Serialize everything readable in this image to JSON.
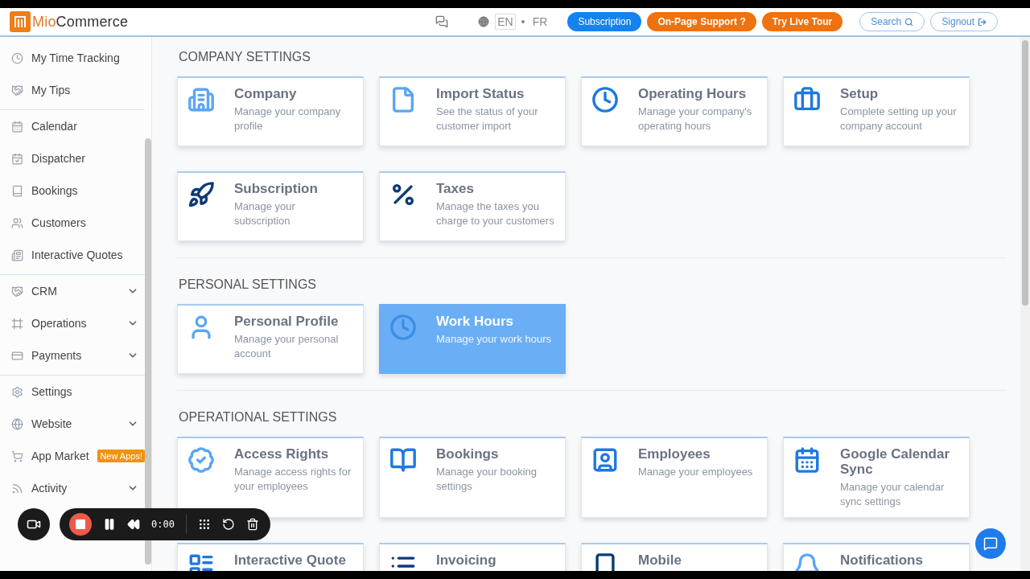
{
  "header": {
    "brand_prefix": "Mio",
    "brand_suffix": "Commerce",
    "languages": [
      {
        "label": "EN",
        "selected": true
      },
      {
        "label": "FR",
        "selected": false
      }
    ],
    "buttons": [
      {
        "label": "Subscription",
        "kind": "primary"
      },
      {
        "label": "On-Page Support ?",
        "kind": "accent"
      },
      {
        "label": "Try Live Tour",
        "kind": "accent"
      },
      {
        "label": "Search",
        "kind": "search"
      },
      {
        "label": "Signout",
        "kind": "signout"
      }
    ]
  },
  "sidebar": {
    "groups": [
      [
        {
          "label": "My Time Tracking",
          "expandable": false
        },
        {
          "label": "My Tips",
          "expandable": false
        }
      ],
      [
        {
          "label": "Calendar",
          "expandable": false
        },
        {
          "label": "Dispatcher",
          "expandable": false
        },
        {
          "label": "Bookings",
          "expandable": false
        },
        {
          "label": "Customers",
          "expandable": false
        },
        {
          "label": "Interactive Quotes",
          "expandable": false
        }
      ],
      [
        {
          "label": "CRM",
          "expandable": true
        },
        {
          "label": "Operations",
          "expandable": true
        },
        {
          "label": "Payments",
          "expandable": true
        }
      ],
      [
        {
          "label": "Settings",
          "expandable": false
        },
        {
          "label": "Website",
          "expandable": true
        },
        {
          "label": "App Market",
          "expandable": false,
          "badge": "New Apps!"
        },
        {
          "label": "Activity",
          "expandable": true
        }
      ]
    ]
  },
  "sections": [
    {
      "title": "COMPANY SETTINGS",
      "cards": [
        {
          "title": "Company",
          "description": "Manage your company profile",
          "selected": false
        },
        {
          "title": "Import Status",
          "description": "See the status of your customer import",
          "selected": false
        },
        {
          "title": "Operating Hours",
          "description": "Manage your company's operating hours",
          "selected": false
        },
        {
          "title": "Setup",
          "description": "Complete setting up your company account",
          "selected": false
        },
        {
          "title": "Subscription",
          "description": "Manage your subscription",
          "selected": false
        },
        {
          "title": "Taxes",
          "description": "Manage the taxes you charge to your customers",
          "selected": false
        }
      ]
    },
    {
      "title": "PERSONAL SETTINGS",
      "cards": [
        {
          "title": "Personal Profile",
          "description": "Manage your personal account",
          "selected": false
        },
        {
          "title": "Work Hours",
          "description": "Manage your work hours",
          "selected": true
        }
      ]
    },
    {
      "title": "OPERATIONAL SETTINGS",
      "cards": [
        {
          "title": "Access Rights",
          "description": "Manage access rights for your employees",
          "selected": false
        },
        {
          "title": "Bookings",
          "description": "Manage your booking settings",
          "selected": false
        },
        {
          "title": "Employees",
          "description": "Manage your employees",
          "selected": false
        },
        {
          "title": "Google Calendar Sync",
          "description": "Manage your calendar sync settings",
          "selected": false
        },
        {
          "title": "Interactive Quote",
          "selected": false
        },
        {
          "title": "Invoicing",
          "selected": false
        },
        {
          "title": "Mobile",
          "selected": false
        },
        {
          "title": "Notifications",
          "selected": false
        }
      ]
    }
  ],
  "recorder": {
    "time": "0:00"
  }
}
